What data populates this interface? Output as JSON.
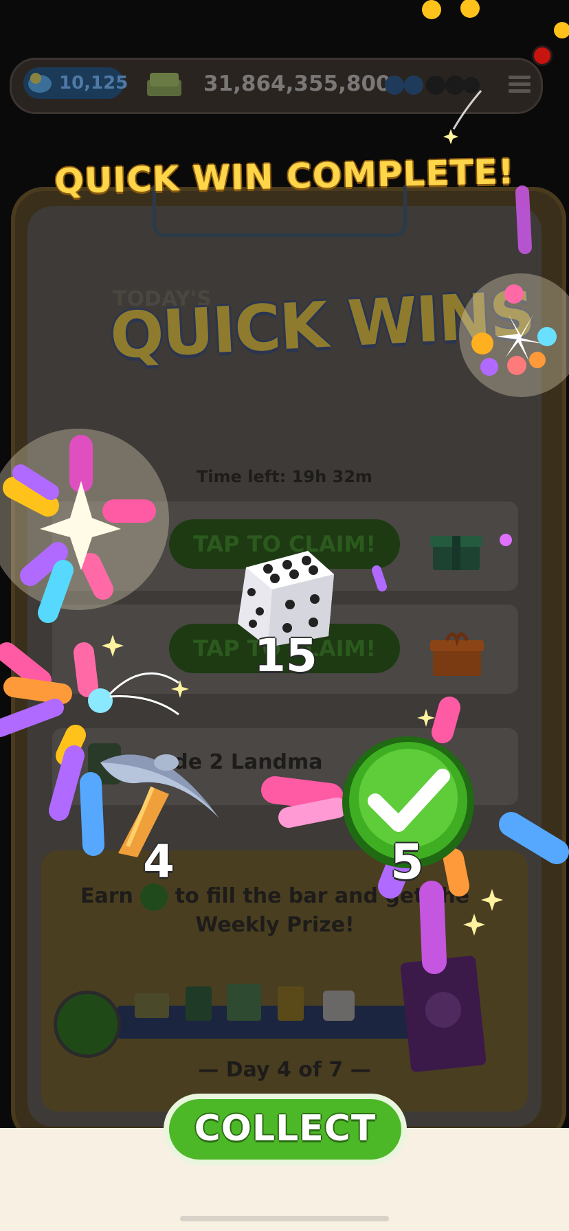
{
  "hud": {
    "token_count": "10,125",
    "cash": "31,864,355,800",
    "menu_icon": "hamburger-menu-icon",
    "notification_dot_color": "#c8140e"
  },
  "banner": {
    "title": "QUICK WIN COMPLETE!"
  },
  "panel": {
    "overline": "TODAY'S",
    "heading": "QUICK WINS",
    "time_left": "Time left: 19h 32m",
    "tasks": [
      {
        "button": "TAP TO CLAIM!",
        "reward_icon": "green-gift-box-icon"
      },
      {
        "button": "TAP TO CLAIM!",
        "reward_icon": "orange-gift-box-icon"
      }
    ],
    "landmark_task": "ade 2 Landma",
    "weekly_text_line1": "Earn",
    "weekly_text_line1b": "to fill the bar and get the",
    "weekly_text_line2": "Weekly Prize!",
    "day": "— Day 4 of 7 —"
  },
  "rewards": {
    "dice": {
      "icon": "dice-icon",
      "count": "15"
    },
    "pickaxe": {
      "icon": "pickaxe-icon",
      "count": "4"
    },
    "checkmark": {
      "icon": "green-check-token-icon",
      "count": "5"
    }
  },
  "collect_button": "COLLECT",
  "colors": {
    "banner_gold": "#ffd54a",
    "collect_green": "#4cb828",
    "check_green": "#3fae23"
  }
}
